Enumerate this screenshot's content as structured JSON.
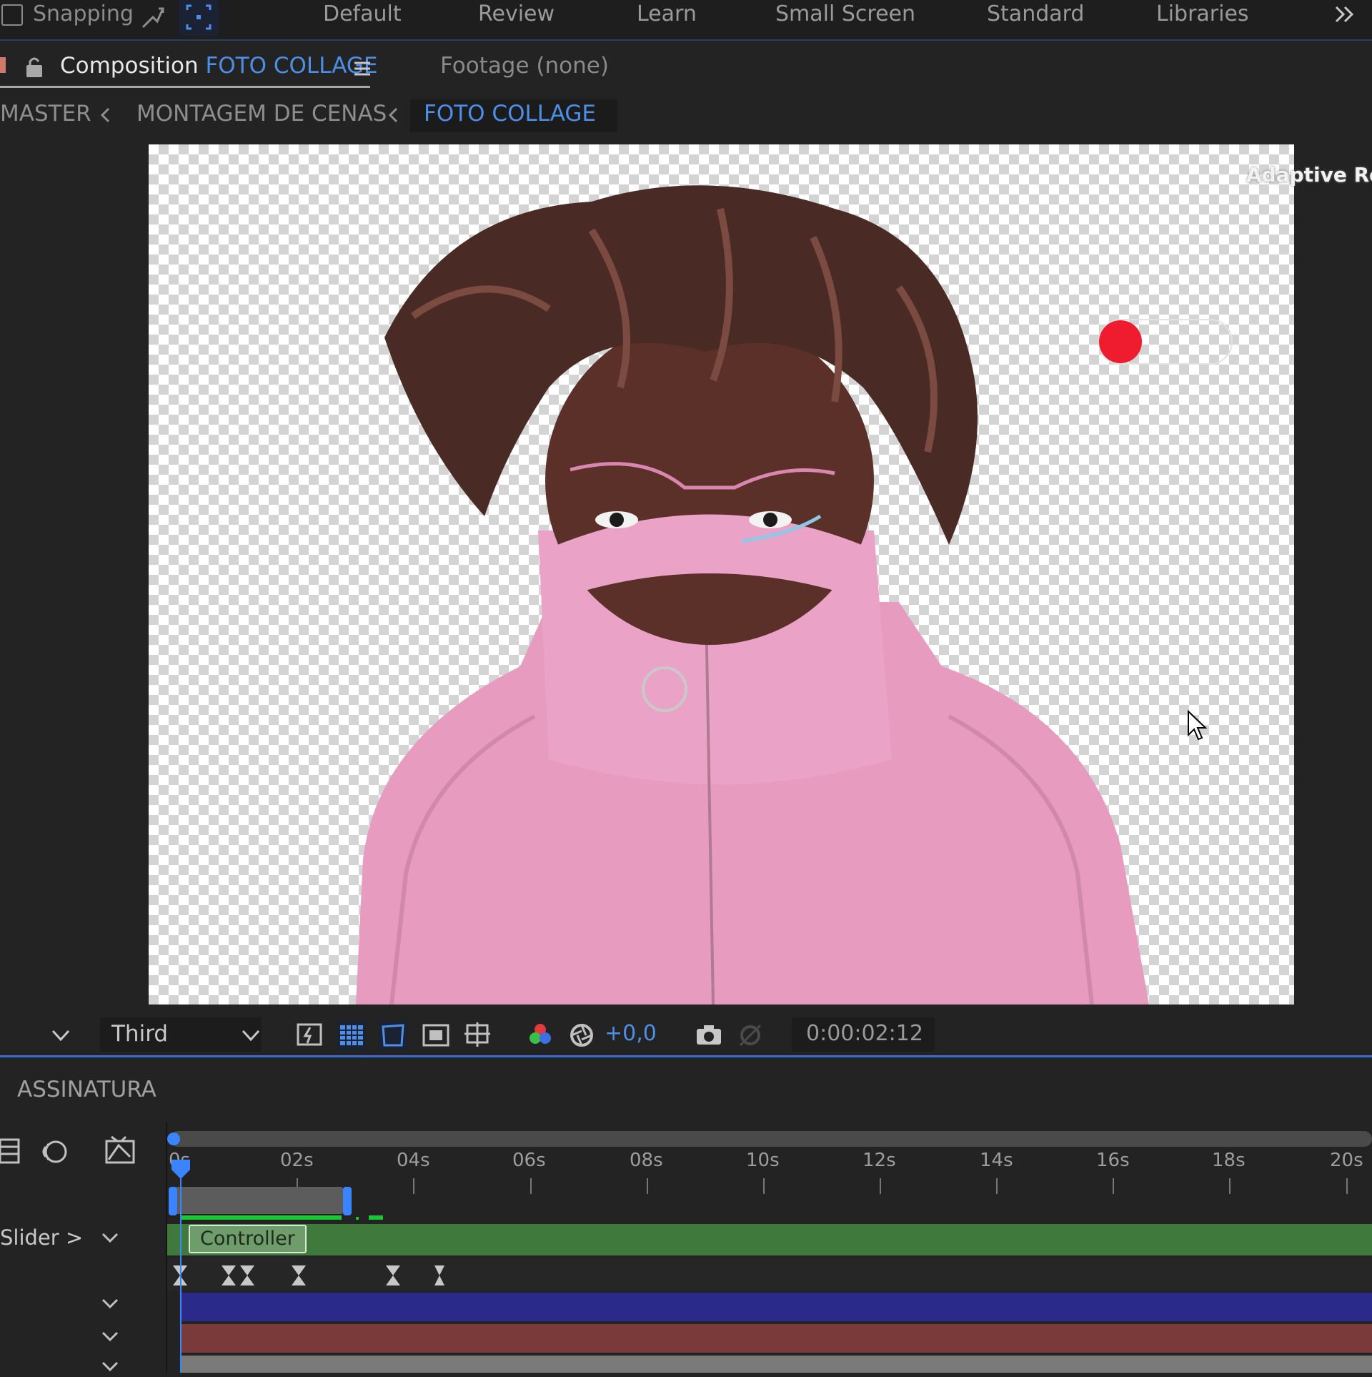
{
  "topbar": {
    "snapping_label": "Snapping",
    "workspaces": [
      "Default",
      "Review",
      "Learn",
      "Small Screen",
      "Standard",
      "Libraries"
    ],
    "overflow_icon": "double-chevron-right-icon"
  },
  "panel": {
    "composition_prefix": "Composition",
    "composition_name": "FOTO COLLAGE",
    "footage_label": "Footage  (none)"
  },
  "breadcrumb": {
    "items": [
      "MASTER",
      "MONTAGEM DE CENAS",
      "FOTO COLLAGE"
    ]
  },
  "viewer": {
    "adaptive_text": "Adaptive Reso",
    "red_dot_color": "#ee1c2e"
  },
  "viewer_toolbar": {
    "resolution": "Third",
    "exposure": "+0,0",
    "timecode": "0:00:02:12"
  },
  "timeline": {
    "title": "ASSINATURA",
    "ruler": [
      "0s",
      "02s",
      "04s",
      "06s",
      "08s",
      "10s",
      "12s",
      "14s",
      "16s",
      "18s",
      "20s"
    ],
    "layers": [
      {
        "label": "Slider >",
        "bar_label": "Controller",
        "color": "#3f7a3c"
      },
      {
        "label": "",
        "color": "#2a2a8a"
      },
      {
        "label": "",
        "color": "#7a3a3a"
      },
      {
        "label": "",
        "color": "#7a7a7a"
      }
    ]
  }
}
